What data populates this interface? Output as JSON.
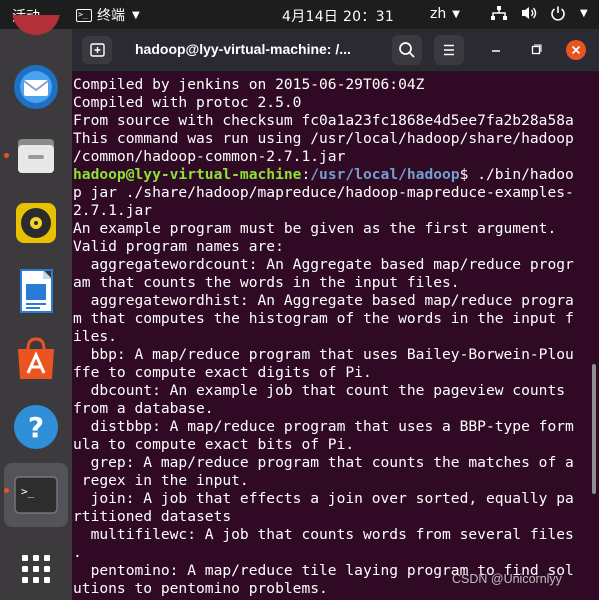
{
  "topbar": {
    "activities": "活动",
    "app_name": "终端",
    "clock": "4月14日  20：31",
    "input_method": "zh"
  },
  "window": {
    "title": "hadoop@lyy-virtual-machine: /..."
  },
  "terminal": {
    "pre_lines": [
      "Compiled by jenkins on 2015-06-29T06:04Z",
      "Compiled with protoc 2.5.0",
      "From source with checksum fc0a1a23fc1868e4d5ee7fa2b28a58a",
      "This command was run using /usr/local/hadoop/share/hadoop",
      "/common/hadoop-common-2.7.1.jar"
    ],
    "prompt_user": "hadoop@lyy-virtual-machine",
    "prompt_colon": ":",
    "prompt_path": "/usr/local/hadoop",
    "prompt_command": "$ ./bin/hadoo",
    "post_lines": [
      "p jar ./share/hadoop/mapreduce/hadoop-mapreduce-examples-",
      "2.7.1.jar",
      "An example program must be given as the first argument.",
      "Valid program names are:",
      "  aggregatewordcount: An Aggregate based map/reduce progr",
      "am that counts the words in the input files.",
      "  aggregatewordhist: An Aggregate based map/reduce progra",
      "m that computes the histogram of the words in the input f",
      "iles.",
      "  bbp: A map/reduce program that uses Bailey-Borwein-Plou",
      "ffe to compute exact digits of Pi.",
      "  dbcount: An example job that count the pageview counts",
      "from a database.",
      "  distbbp: A map/reduce program that uses a BBP-type form",
      "ula to compute exact bits of Pi.",
      "  grep: A map/reduce program that counts the matches of a",
      " regex in the input.",
      "  join: A job that effects a join over sorted, equally pa",
      "rtitioned datasets",
      "  multifilewc: A job that counts words from several files",
      ".",
      "  pentomino: A map/reduce tile laying program to find sol",
      "utions to pentomino problems."
    ]
  },
  "watermark": "CSDN @Unicornlyy",
  "colors": {
    "accent": "#e95420",
    "terminal_bg": "#300a24",
    "prompt_user": "#8ae234",
    "prompt_path": "#729fcf"
  },
  "icons": {
    "dock": [
      "thunderbird-icon",
      "files-icon",
      "rhythmbox-icon",
      "writer-icon",
      "software-icon",
      "help-icon",
      "terminal-icon",
      "app-grid-icon"
    ],
    "topbar": [
      "network-icon",
      "volume-icon",
      "power-icon"
    ]
  }
}
